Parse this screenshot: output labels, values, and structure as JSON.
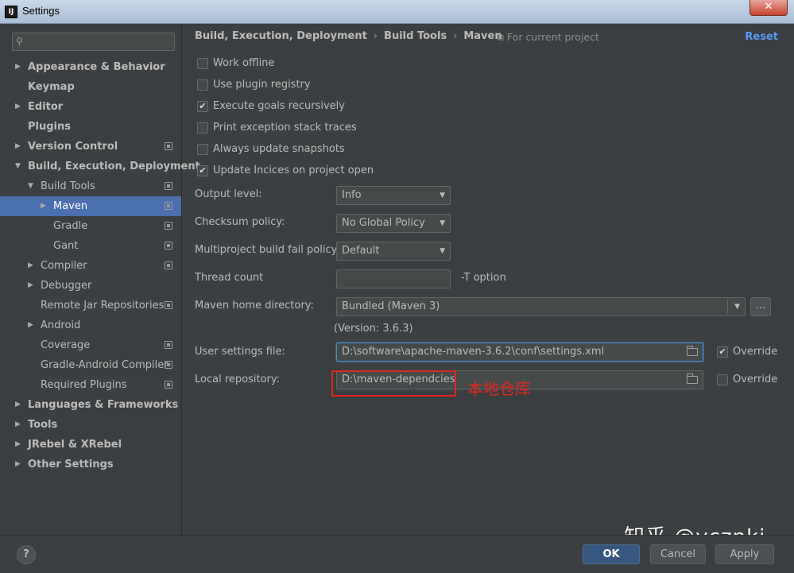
{
  "window": {
    "title": "Settings",
    "app_icon_text": "IJ",
    "close_glyph": "✕"
  },
  "sidebar": {
    "search_placeholder": "",
    "items": [
      {
        "label": "Appearance & Behavior",
        "arrow": "▶",
        "bold": true
      },
      {
        "label": "Keymap",
        "bold": true
      },
      {
        "label": "Editor",
        "arrow": "▶",
        "bold": true
      },
      {
        "label": "Plugins",
        "bold": true
      },
      {
        "label": "Version Control",
        "arrow": "▶",
        "bold": true,
        "project": true
      },
      {
        "label": "Build, Execution, Deployment",
        "arrow": "▼",
        "bold": true
      },
      {
        "label": "Build Tools",
        "arrow": "▼",
        "project": true
      },
      {
        "label": "Maven",
        "arrow": "▶",
        "project": true,
        "selected": true
      },
      {
        "label": "Gradle",
        "project": true
      },
      {
        "label": "Gant",
        "project": true
      },
      {
        "label": "Compiler",
        "arrow": "▶",
        "project": true
      },
      {
        "label": "Debugger",
        "arrow": "▶"
      },
      {
        "label": "Remote Jar Repositories",
        "project": true
      },
      {
        "label": "Android",
        "arrow": "▶"
      },
      {
        "label": "Coverage",
        "project": true
      },
      {
        "label": "Gradle-Android Compiler",
        "project": true
      },
      {
        "label": "Required Plugins",
        "project": true
      },
      {
        "label": "Languages & Frameworks",
        "arrow": "▶",
        "bold": true
      },
      {
        "label": "Tools",
        "arrow": "▶",
        "bold": true
      },
      {
        "label": "JRebel & XRebel",
        "arrow": "▶",
        "bold": true
      },
      {
        "label": "Other Settings",
        "arrow": "▶",
        "bold": true
      }
    ]
  },
  "breadcrumb": {
    "items": [
      "Build, Execution, Deployment",
      "Build Tools",
      "Maven"
    ],
    "separator": "›",
    "for_project": "For current project",
    "reset": "Reset"
  },
  "checkboxes": [
    {
      "label": "Work offline",
      "checked": false
    },
    {
      "label": "Use plugin registry",
      "checked": false
    },
    {
      "label": "Execute goals recursively",
      "checked": true
    },
    {
      "label": "Print exception stack traces",
      "checked": false
    },
    {
      "label": "Always update snapshots",
      "checked": false
    },
    {
      "label": "Update Incices on project open",
      "checked": true
    }
  ],
  "form": {
    "output_level": {
      "label": "Output level:",
      "value": "Info"
    },
    "checksum_policy": {
      "label": "Checksum policy:",
      "value": "No Global Policy"
    },
    "fail_policy": {
      "label": "Multiproject build fail policy:",
      "value": "Default"
    },
    "thread_count": {
      "label": "Thread count",
      "value": "",
      "suffix": "-T option"
    },
    "maven_home": {
      "label": "Maven home directory:",
      "value": "Bundled (Maven 3)",
      "browse": "...",
      "version": "(Version: 3.6.3)"
    },
    "user_settings": {
      "label": "User settings file:",
      "value": "D:\\software\\apache-maven-3.6.2\\conf\\settings.xml",
      "override_label": "Override",
      "override_checked": true
    },
    "local_repo": {
      "label": "Local repository:",
      "value": "D:\\maven-dependcies",
      "override_label": "Override",
      "override_checked": false
    }
  },
  "annotation": "本地仓库",
  "watermark": "知乎 @ycznkj",
  "buttons": {
    "help": "?",
    "ok": "OK",
    "cancel": "Cancel",
    "apply": "Apply"
  },
  "colors": {
    "selection": "#4b6eaf",
    "link": "#589df6",
    "annotation": "#e0271c",
    "primary": "#365880"
  }
}
